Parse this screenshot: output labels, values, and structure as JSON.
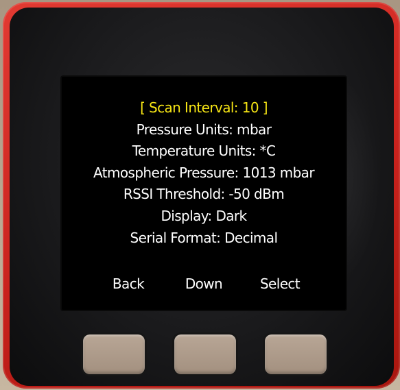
{
  "menu": {
    "items": [
      {
        "label": "[ Scan Interval: 10 ]",
        "selected": true
      },
      {
        "label": "Pressure Units: mbar",
        "selected": false
      },
      {
        "label": "Temperature Units: *C",
        "selected": false
      },
      {
        "label": "Atmospheric Pressure: 1013 mbar",
        "selected": false
      },
      {
        "label": "RSSI Threshold: -50 dBm",
        "selected": false
      },
      {
        "label": "Display: Dark",
        "selected": false
      },
      {
        "label": "Serial Format: Decimal",
        "selected": false
      }
    ]
  },
  "softkeys": {
    "back": "Back",
    "down": "Down",
    "select": "Select"
  },
  "colors": {
    "selected_text": "#f6e514",
    "text": "#ffffff",
    "screen_bg": "#000000",
    "case": "#c9221d"
  }
}
